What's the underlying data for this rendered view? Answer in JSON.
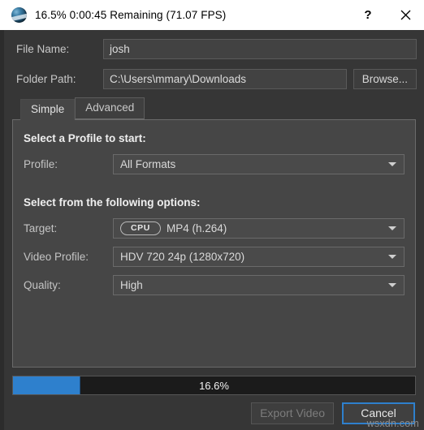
{
  "titlebar": {
    "icon": "openshot-logo-icon",
    "title": "16.5%  0:00:45 Remaining (71.07 FPS)",
    "help_label": "?",
    "close_label": "✕"
  },
  "form": {
    "file_name_label": "File Name:",
    "file_name_value": "josh",
    "file_name_placeholder": "",
    "folder_path_label": "Folder Path:",
    "folder_path_value": "C:\\Users\\mmary\\Downloads",
    "folder_path_placeholder": "",
    "browse_label": "Browse..."
  },
  "tabs": [
    {
      "label": "Simple",
      "active": true
    },
    {
      "label": "Advanced",
      "active": false
    }
  ],
  "panel": {
    "profile_heading": "Select a Profile to start:",
    "profile_label": "Profile:",
    "profile_value": "All Formats",
    "options_heading": "Select from the following options:",
    "target_label": "Target:",
    "target_badge": "CPU",
    "target_value": "MP4 (h.264)",
    "video_profile_label": "Video Profile:",
    "video_profile_value": "HDV 720 24p (1280x720)",
    "quality_label": "Quality:",
    "quality_value": "High"
  },
  "progress": {
    "percent_label": "16.6%",
    "percent_value": 16.6,
    "fill_color": "#2e80cd",
    "track_color": "#1b1b1b"
  },
  "footer": {
    "export_label": "Export Video",
    "cancel_label": "Cancel"
  },
  "watermark": "wsxdn.com"
}
